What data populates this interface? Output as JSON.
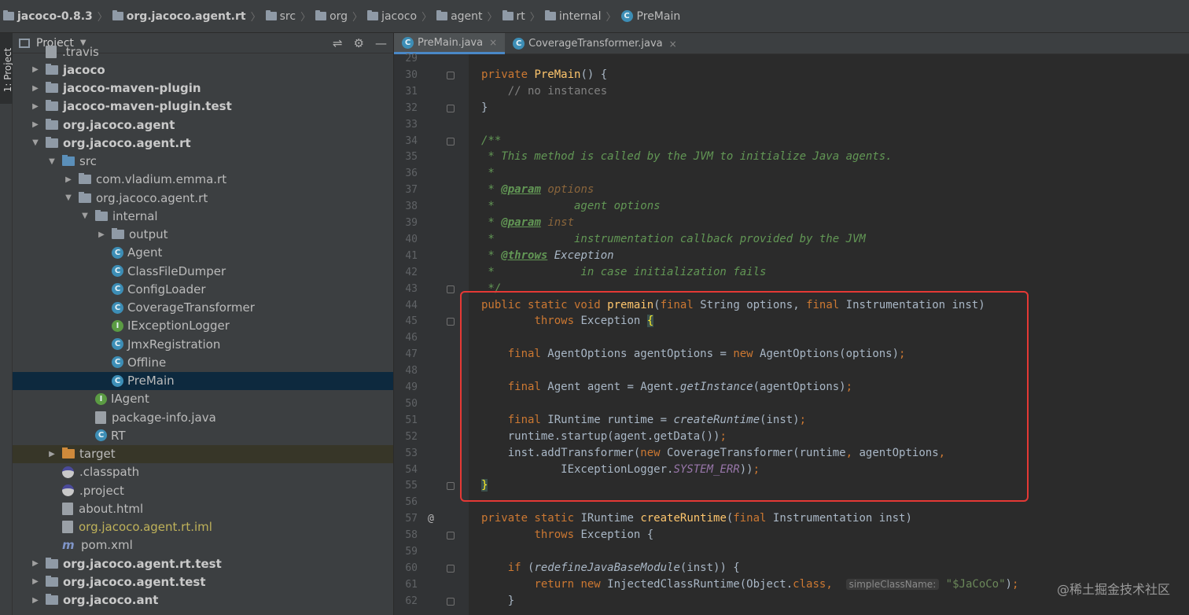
{
  "breadcrumb": [
    "jacoco-0.8.3",
    "org.jacoco.agent.rt",
    "src",
    "org",
    "jacoco",
    "agent",
    "rt",
    "internal",
    "PreMain"
  ],
  "toolstrip": {
    "label": "1: Project"
  },
  "project_panel": {
    "title": "Project",
    "items": [
      {
        "label": ".travis",
        "depth": 1,
        "arrow": "",
        "icon": "file",
        "bold": false
      },
      {
        "label": "jacoco",
        "depth": 1,
        "arrow": "▶",
        "icon": "folder",
        "bold": true
      },
      {
        "label": "jacoco-maven-plugin",
        "depth": 1,
        "arrow": "▶",
        "icon": "folder",
        "bold": true
      },
      {
        "label": "jacoco-maven-plugin.test",
        "depth": 1,
        "arrow": "▶",
        "icon": "folder",
        "bold": true
      },
      {
        "label": "org.jacoco.agent",
        "depth": 1,
        "arrow": "▶",
        "icon": "folder",
        "bold": true
      },
      {
        "label": "org.jacoco.agent.rt",
        "depth": 1,
        "arrow": "▼",
        "icon": "folder",
        "bold": true
      },
      {
        "label": "src",
        "depth": 2,
        "arrow": "▼",
        "icon": "src",
        "bold": false
      },
      {
        "label": "com.vladium.emma.rt",
        "depth": 3,
        "arrow": "▶",
        "icon": "folder",
        "bold": false
      },
      {
        "label": "org.jacoco.agent.rt",
        "depth": 3,
        "arrow": "▼",
        "icon": "folder",
        "bold": false
      },
      {
        "label": "internal",
        "depth": 4,
        "arrow": "▼",
        "icon": "folder",
        "bold": false
      },
      {
        "label": "output",
        "depth": 5,
        "arrow": "▶",
        "icon": "folder",
        "bold": false
      },
      {
        "label": "Agent",
        "depth": 5,
        "arrow": "",
        "icon": "class",
        "bold": false
      },
      {
        "label": "ClassFileDumper",
        "depth": 5,
        "arrow": "",
        "icon": "class",
        "bold": false
      },
      {
        "label": "ConfigLoader",
        "depth": 5,
        "arrow": "",
        "icon": "class",
        "bold": false
      },
      {
        "label": "CoverageTransformer",
        "depth": 5,
        "arrow": "",
        "icon": "class",
        "bold": false
      },
      {
        "label": "IExceptionLogger",
        "depth": 5,
        "arrow": "",
        "icon": "interface",
        "bold": false
      },
      {
        "label": "JmxRegistration",
        "depth": 5,
        "arrow": "",
        "icon": "class",
        "bold": false
      },
      {
        "label": "Offline",
        "depth": 5,
        "arrow": "",
        "icon": "class",
        "bold": false
      },
      {
        "label": "PreMain",
        "depth": 5,
        "arrow": "",
        "icon": "class",
        "bold": false,
        "selected": true
      },
      {
        "label": "IAgent",
        "depth": 4,
        "arrow": "",
        "icon": "interface",
        "bold": false
      },
      {
        "label": "package-info.java",
        "depth": 4,
        "arrow": "",
        "icon": "file",
        "bold": false
      },
      {
        "label": "RT",
        "depth": 4,
        "arrow": "",
        "icon": "class",
        "bold": false
      },
      {
        "label": "target",
        "depth": 2,
        "arrow": "▶",
        "icon": "orange",
        "bold": false,
        "excluded": true
      },
      {
        "label": ".classpath",
        "depth": 2,
        "arrow": "",
        "icon": "cp",
        "bold": false
      },
      {
        "label": ".project",
        "depth": 2,
        "arrow": "",
        "icon": "cp",
        "bold": false
      },
      {
        "label": "about.html",
        "depth": 2,
        "arrow": "",
        "icon": "file",
        "bold": false
      },
      {
        "label": "org.jacoco.agent.rt.iml",
        "depth": 2,
        "arrow": "",
        "icon": "file",
        "bold": false,
        "yellow": true
      },
      {
        "label": "pom.xml",
        "depth": 2,
        "arrow": "",
        "icon": "maven",
        "bold": false
      },
      {
        "label": "org.jacoco.agent.rt.test",
        "depth": 1,
        "arrow": "▶",
        "icon": "folder",
        "bold": true
      },
      {
        "label": "org.jacoco.agent.test",
        "depth": 1,
        "arrow": "▶",
        "icon": "folder",
        "bold": true
      },
      {
        "label": "org.jacoco.ant",
        "depth": 1,
        "arrow": "▶",
        "icon": "folder",
        "bold": true
      }
    ]
  },
  "editor_tabs": [
    {
      "label": "PreMain.java",
      "active": true
    },
    {
      "label": "CoverageTransformer.java",
      "active": false
    }
  ],
  "code_lines": [
    {
      "n": "29",
      "html": ""
    },
    {
      "n": "30",
      "html": "<span class=\"kw\">private</span> <span class=\"fn\">PreMain</span>() {",
      "fold": true
    },
    {
      "n": "31",
      "html": "    <span class=\"cm\">// no instances</span>"
    },
    {
      "n": "32",
      "html": "}",
      "fold": true
    },
    {
      "n": "33",
      "html": ""
    },
    {
      "n": "34",
      "html": "<span class=\"doc\">/**</span>",
      "fold": true
    },
    {
      "n": "35",
      "html": "<span class=\"doc\"> * This method is called by the JVM to initialize Java agents.</span>"
    },
    {
      "n": "36",
      "html": "<span class=\"doc\"> *</span>"
    },
    {
      "n": "37",
      "html": "<span class=\"doc\"> * </span><span class=\"tag\">@param</span> <span class=\"dparam\">options</span>"
    },
    {
      "n": "38",
      "html": "<span class=\"doc\"> *            agent options</span>"
    },
    {
      "n": "39",
      "html": "<span class=\"doc\"> * </span><span class=\"tag\">@param</span> <span class=\"dparam\">inst</span>"
    },
    {
      "n": "40",
      "html": "<span class=\"doc\"> *            instrumentation callback provided by the JVM</span>"
    },
    {
      "n": "41",
      "html": "<span class=\"doc\"> * </span><span class=\"tag\">@throws</span> <span class=\"doc\" style=\"color:#a9b7c6\">Exception</span>"
    },
    {
      "n": "42",
      "html": "<span class=\"doc\"> *             in case initialization fails</span>"
    },
    {
      "n": "43",
      "html": "<span class=\"doc\"> */</span>",
      "fold": true
    },
    {
      "n": "44",
      "html": "<span class=\"kw\">public static void</span> <span class=\"fn\">premain</span>(<span class=\"kw\">final</span> String options, <span class=\"kw\">final</span> Instrumentation inst)"
    },
    {
      "n": "45",
      "html": "        <span class=\"kw\">throws</span> Exception <span class=\"brace\">{</span>",
      "fold": true
    },
    {
      "n": "46",
      "html": ""
    },
    {
      "n": "47",
      "html": "    <span class=\"kw\">final</span> AgentOptions agentOptions = <span class=\"kw\">new</span> AgentOptions(options)<span class=\"kw\">;</span>"
    },
    {
      "n": "48",
      "html": ""
    },
    {
      "n": "49",
      "html": "    <span class=\"kw\">final</span> Agent agent = Agent.<span class=\"it\">getInstance</span>(agentOptions)<span class=\"kw\">;</span>"
    },
    {
      "n": "50",
      "html": ""
    },
    {
      "n": "51",
      "html": "    <span class=\"kw\">final</span> IRuntime runtime = <span class=\"it\">createRuntime</span>(inst)<span class=\"kw\">;</span>"
    },
    {
      "n": "52",
      "html": "    runtime.startup(agent.getData())<span class=\"kw\">;</span>"
    },
    {
      "n": "53",
      "html": "    inst.addTransformer(<span class=\"kw\">new</span> CoverageTransformer(runtime<span class=\"kw\">,</span> agentOptions<span class=\"kw\">,</span>"
    },
    {
      "n": "54",
      "html": "            IExceptionLogger.<span class=\"st\">SYSTEM_ERR</span>))<span class=\"kw\">;</span>"
    },
    {
      "n": "55",
      "html": "<span class=\"brace\">}</span>",
      "fold": true
    },
    {
      "n": "56",
      "html": ""
    },
    {
      "n": "57",
      "html": "<span class=\"kw\">private static</span> IRuntime <span class=\"fn\">createRuntime</span>(<span class=\"kw\">final</span> Instrumentation inst)",
      "annotation": "@"
    },
    {
      "n": "58",
      "html": "        <span class=\"kw\">throws</span> Exception {",
      "fold": true
    },
    {
      "n": "59",
      "html": ""
    },
    {
      "n": "60",
      "html": "    <span class=\"kw\">if</span> (<span class=\"it\">redefineJavaBaseModule</span>(inst)) {",
      "fold": true
    },
    {
      "n": "61",
      "html": "        <span class=\"kw\">return new</span> InjectedClassRuntime(Object.<span class=\"kw\">class,</span>  <span class=\"hint\">simpleClassName:</span> <span class=\"str\">\"$JaCoCo\"</span>)<span class=\"kw\">;</span>"
    },
    {
      "n": "62",
      "html": "    }",
      "fold": true
    }
  ],
  "watermark": "@稀土掘金技术社区"
}
